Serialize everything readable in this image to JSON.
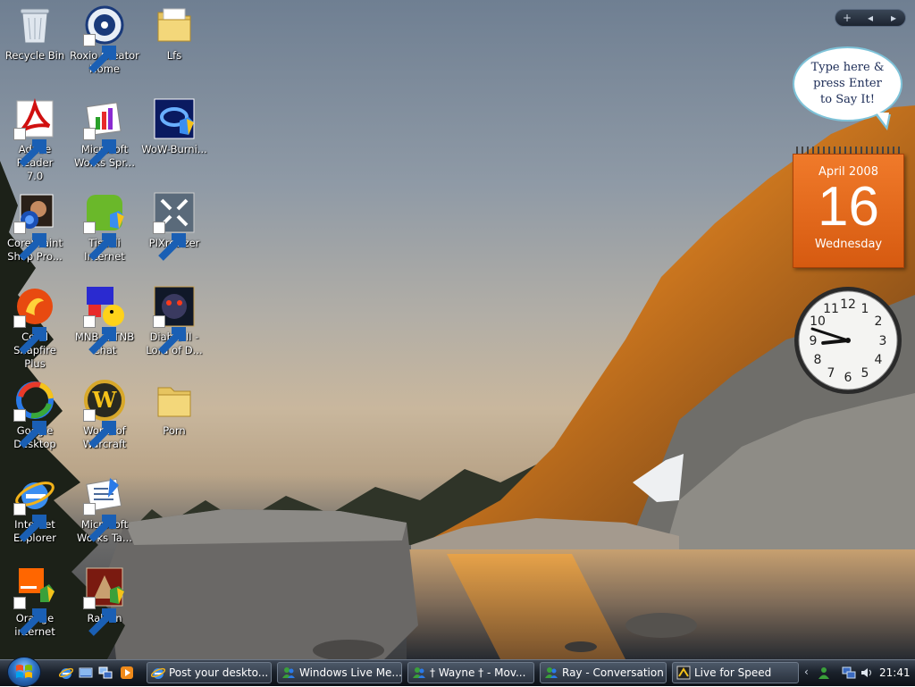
{
  "desktop_icons": [
    {
      "label": "Recycle Bin",
      "icon": "recycle-bin-icon"
    },
    {
      "label": "Roxio Creator\nHome",
      "icon": "roxio-icon"
    },
    {
      "label": "Lfs",
      "icon": "folder-icon"
    },
    {
      "label": "Adobe Reader\n7.0",
      "icon": "adobe-reader-icon"
    },
    {
      "label": "Microsoft\nWorks Spr...",
      "icon": "works-spreadsheet-icon"
    },
    {
      "label": "WoW-Burni...",
      "icon": "wow-burning-icon"
    },
    {
      "label": "Corel Paint\nShop Pro...",
      "icon": "corel-paint-icon"
    },
    {
      "label": "Tiscali\nInternet",
      "icon": "tiscali-icon"
    },
    {
      "label": "PIXresizer",
      "icon": "pixresizer-icon"
    },
    {
      "label": "Corel Snapfire\nPlus",
      "icon": "corel-snapfire-icon"
    },
    {
      "label": "MNB & TNB\nChat",
      "icon": "mnb-chat-icon"
    },
    {
      "label": "Diablo II -\nLord of D...",
      "icon": "diablo-icon"
    },
    {
      "label": "Google\nDesktop",
      "icon": "google-desktop-icon"
    },
    {
      "label": "World of\nWarcraft",
      "icon": "wow-icon"
    },
    {
      "label": "Porn",
      "icon": "folder-icon"
    },
    {
      "label": "Internet\nExplorer",
      "icon": "internet-explorer-icon"
    },
    {
      "label": "Microsoft\nWorks Ta...",
      "icon": "works-task-icon"
    },
    {
      "label": "Orange\ninternet",
      "icon": "orange-icon"
    },
    {
      "label": "Rakion",
      "icon": "rakion-icon"
    }
  ],
  "sidebar": {
    "controls": {
      "add": "+",
      "prev": "◂",
      "next": "▸"
    },
    "say_it": {
      "text": "Type here &\npress Enter\nto Say It!"
    },
    "calendar": {
      "month": "April 2008",
      "day": "16",
      "weekday": "Wednesday"
    },
    "clock": {
      "hour": 8,
      "minute": 48
    }
  },
  "taskbar": {
    "tasks": [
      {
        "label": "Post your deskto...",
        "icon": "internet-explorer-icon"
      },
      {
        "label": "Windows Live Me...",
        "icon": "messenger-icon"
      },
      {
        "label": "† Wayne  † - Mov...",
        "icon": "messenger-icon"
      },
      {
        "label": "Ray - Conversation",
        "icon": "messenger-icon"
      },
      {
        "label": "Live for Speed",
        "icon": "lfs-icon"
      }
    ],
    "tray": {
      "time": "21:41"
    }
  },
  "colors": {
    "calendar": "#e8681c",
    "bubble_border": "#7ec3d9",
    "taskbar": "#1b222c"
  }
}
